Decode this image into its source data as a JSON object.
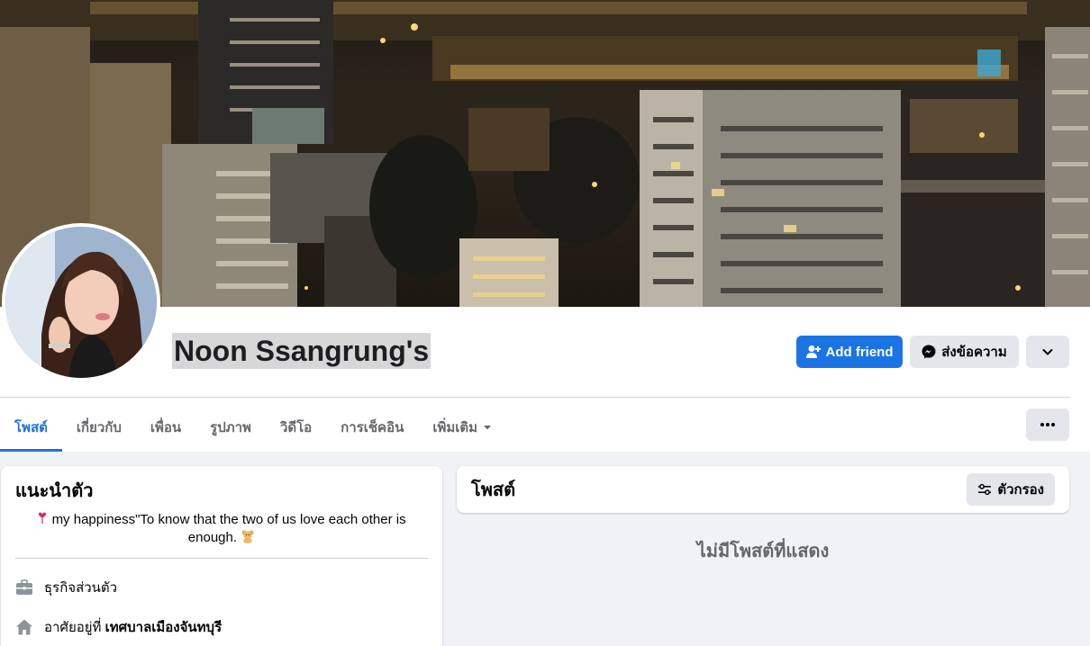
{
  "profile": {
    "name": "Noon Ssangrung's",
    "add_friend_label": "Add friend",
    "message_label": "ส่งข้อความ"
  },
  "tabs": [
    {
      "label": "โพสต์",
      "active": true
    },
    {
      "label": "เกี่ยวกับ",
      "active": false
    },
    {
      "label": "เพื่อน",
      "active": false
    },
    {
      "label": "รูปภาพ",
      "active": false
    },
    {
      "label": "วิดีโอ",
      "active": false
    },
    {
      "label": "การเช็คอิน",
      "active": false
    },
    {
      "label": "เพิ่มเติม",
      "active": false
    }
  ],
  "intro": {
    "title": "แนะนำตัว",
    "bio": "my happiness\"To know that the two of us love each other is enough.",
    "work": "ธุรกิจส่วนตัว",
    "lives_in_prefix": "อาศัยอยู่ที่",
    "lives_in_place": "เทศบาลเมืองจันทบุรี"
  },
  "posts": {
    "title": "โพสต์",
    "filter_label": "ตัวกรอง",
    "empty_message": "ไม่มีโพสต์ที่แสดง"
  },
  "colors": {
    "accent": "#1b74e4",
    "button_gray": "#e4e6eb",
    "page_bg": "#f0f2f5",
    "secondary_text": "#65676b"
  },
  "icons": {
    "add_friend": "person-plus-icon",
    "message": "messenger-icon",
    "dropdown": "chevron-down-icon",
    "more": "ellipsis-icon",
    "filter": "sliders-icon",
    "work": "briefcase-icon",
    "home": "home-icon",
    "bio_prefix": "heart-emoji-icon",
    "bio_suffix": "bear-emoji-icon"
  }
}
